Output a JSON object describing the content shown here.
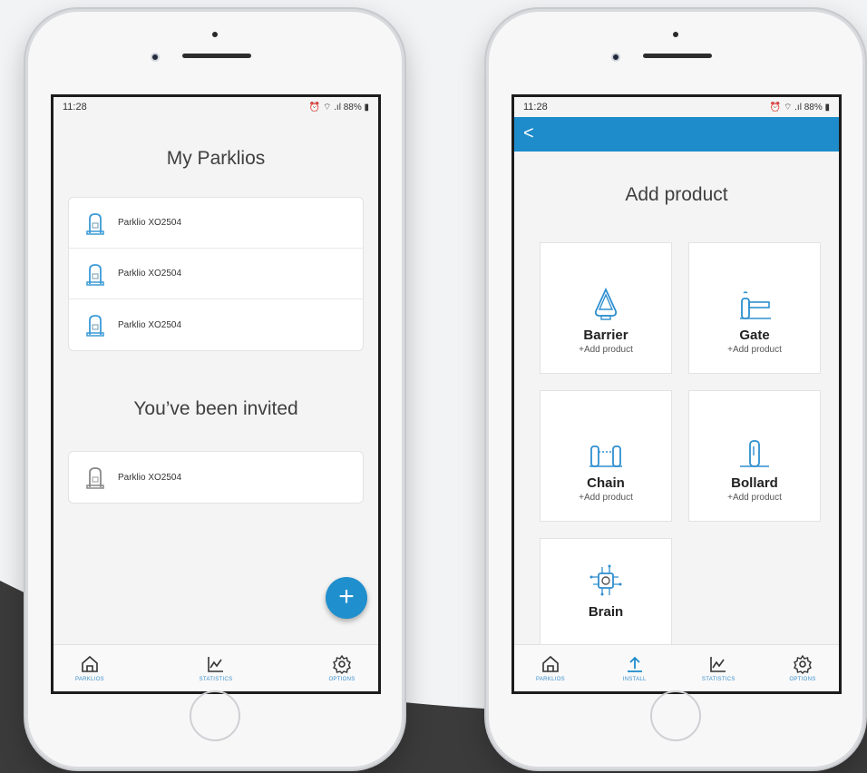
{
  "left_phone": {
    "status": {
      "time": "11:28",
      "icons": "⏰ ⌔ .ıl 88% ▮"
    },
    "title": "My Parklios",
    "parklios": [
      {
        "name": "Parklio XO2504"
      },
      {
        "name": "Parklio XO2504"
      },
      {
        "name": "Parklio XO2504"
      }
    ],
    "invited_title": "You’ve been invited",
    "invited": [
      {
        "name": "Parklio XO2504"
      }
    ],
    "fab_label": "+",
    "tabs": [
      {
        "label": "PARKLIOS",
        "icon": "home-icon"
      },
      {
        "label": "STATISTICS",
        "icon": "chart-icon"
      },
      {
        "label": "OPTIONS",
        "icon": "gear-icon"
      }
    ]
  },
  "right_phone": {
    "status": {
      "time": "11:28",
      "icons": "⏰ ⌔ .ıl 88% ▮"
    },
    "back_label": "<",
    "title": "Add product",
    "products": [
      {
        "name": "Barrier",
        "action": "+Add product",
        "icon": "barrier-icon"
      },
      {
        "name": "Gate",
        "action": "+Add product",
        "icon": "gate-icon"
      },
      {
        "name": "Chain",
        "action": "+Add product",
        "icon": "chain-icon"
      },
      {
        "name": "Bollard",
        "action": "+Add product",
        "icon": "bollard-icon"
      },
      {
        "name": "Brain",
        "action": "",
        "icon": "brain-icon"
      }
    ],
    "tabs": [
      {
        "label": "PARKLIOS",
        "icon": "home-icon"
      },
      {
        "label": "INSTALL",
        "icon": "upload-icon"
      },
      {
        "label": "STATISTICS",
        "icon": "chart-icon"
      },
      {
        "label": "OPTIONS",
        "icon": "gear-icon"
      }
    ]
  },
  "colors": {
    "accent": "#1e8ccb",
    "background_dark": "#3a3a3b"
  }
}
